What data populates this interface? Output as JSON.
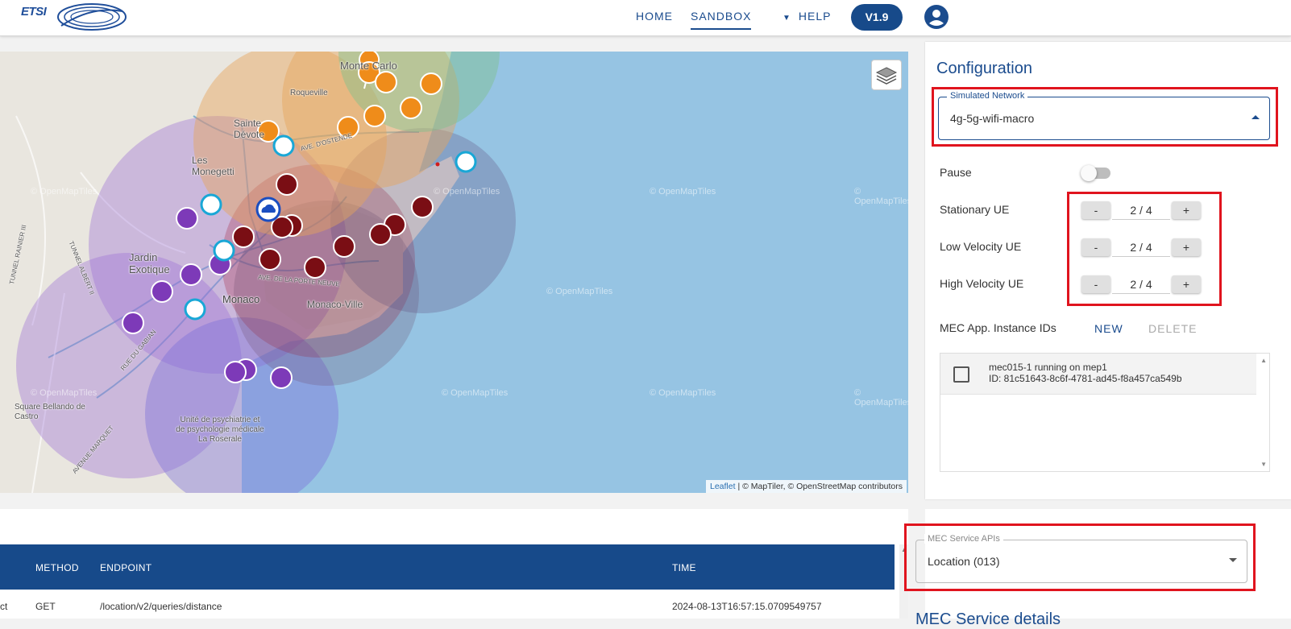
{
  "header": {
    "logo_text": "ETSI",
    "nav": {
      "home": "HOME",
      "sandbox": "SANDBOX",
      "help": "HELP"
    },
    "version": "V1.9",
    "accent": "#1b4c8e"
  },
  "map": {
    "places": [
      "Monte Carlo",
      "Roqueville",
      "Sainte Dévote",
      "Les Monegetti",
      "Jardin Exotique",
      "Monaco",
      "Monaco-Ville",
      "Square Bellando de Castro",
      "Unité de psychiatrie et de psychologie médicale La Roserale"
    ],
    "streets": [
      "TUNNEL RAINIER III",
      "TUNNEL ALBERT II",
      "RUE DU GABIAN",
      "AVENUE MARQUET",
      "AVE. DE LA PORTE NEUVE",
      "AVE. D'OSTENDE"
    ],
    "watermark": "© OpenMapTiles",
    "attribution_link": "Leaflet",
    "attribution_text": "| © MapTiler, © OpenStreetMap contributors"
  },
  "configuration": {
    "title": "Configuration",
    "network_label": "Simulated Network",
    "network_value": "4g-5g-wifi-macro",
    "pause_label": "Pause",
    "pause_on": false,
    "stationary": {
      "label": "Stationary UE",
      "value": "2 / 4"
    },
    "low_velocity": {
      "label": "Low Velocity UE",
      "value": "2 / 4"
    },
    "high_velocity": {
      "label": "High Velocity UE",
      "value": "2 / 4"
    },
    "minus": "-",
    "plus": "+",
    "mec_label": "MEC App. Instance IDs",
    "new_btn": "NEW",
    "delete_btn": "DELETE",
    "instances": [
      {
        "line1": "mec015-1 running on mep1",
        "line2": "ID: 81c51643-8c6f-4781-ad45-f8a457ca549b"
      }
    ]
  },
  "table": {
    "headers": {
      "method": "METHOD",
      "endpoint": "ENDPOINT",
      "time": "TIME"
    },
    "rows": [
      {
        "prefix": "ct",
        "method": "GET",
        "endpoint": "/location/v2/queries/distance",
        "time": "2024-08-13T16:57:15.0709549757"
      }
    ]
  },
  "mec_service": {
    "apis_label": "MEC Service APIs",
    "apis_value": "Location (013)",
    "details_title": "MEC Service details"
  },
  "colors": {
    "highlight": "#e0141e",
    "purple_zone": "#9b6fd6",
    "maroon_marker": "#7a0e14",
    "orange_marker": "#ef8c1a",
    "purple_marker": "#7d3ab8",
    "cyan_marker": "#19a7d6"
  }
}
